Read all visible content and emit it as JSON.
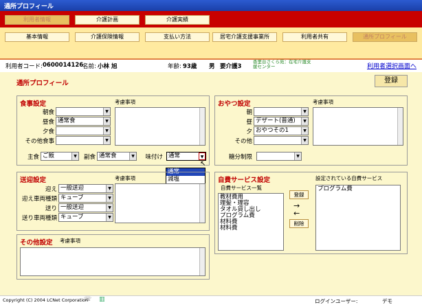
{
  "window": {
    "title": "通所プロフィール"
  },
  "nav_row1": [
    "利用者情報",
    "介護計画",
    "介護実績"
  ],
  "nav_row2": [
    "基本情報",
    "介護保険情報",
    "支払い方法",
    "居宅介護支援事業所",
    "利用者共有",
    "通所プロフィール"
  ],
  "userinfo": {
    "code_label": "利用者コード:",
    "code": "0600014126",
    "name_label": "名前:",
    "name": "小林  旭",
    "age_label": "年齢:",
    "age": "93歳",
    "sex": "男",
    "care_level": "要介護3",
    "facility_line1": "香里台さくら苑：在宅介護支",
    "facility_line2": "援センター",
    "back_link": "利用者選択画面へ"
  },
  "page_title": "通所プロフィール",
  "register_label": "登録",
  "meal": {
    "title": "食事設定",
    "note_label": "考慮事項",
    "rows": [
      {
        "label": "朝食",
        "value": ""
      },
      {
        "label": "昼食",
        "value": "通常食"
      },
      {
        "label": "夕食",
        "value": ""
      },
      {
        "label": "その他食事",
        "value": ""
      }
    ],
    "staple_label": "主食",
    "staple_value": "ご飯",
    "side_label": "副食",
    "side_value": "通常食",
    "seasoning_label": "味付け",
    "seasoning_value": "通常",
    "seasoning_options": [
      "通常",
      "減塩"
    ]
  },
  "snack": {
    "title": "おやつ設定",
    "note_label": "考慮事項",
    "rows": [
      {
        "label": "朝",
        "value": ""
      },
      {
        "label": "昼",
        "value": "デザート(普通)"
      },
      {
        "label": "夕",
        "value": "おやつその1"
      },
      {
        "label": "その他",
        "value": ""
      }
    ],
    "sugar_label": "糖分制限",
    "sugar_value": ""
  },
  "transport": {
    "title": "送迎設定",
    "note_label": "考慮事項",
    "rows": [
      {
        "label": "迎え",
        "value": "一般送迎"
      },
      {
        "label": "迎え車両種類",
        "value": "キューブ"
      },
      {
        "label": "送り",
        "value": "一般送迎"
      },
      {
        "label": "送り車両種類",
        "value": "キューブ"
      }
    ]
  },
  "other": {
    "title": "その他設定",
    "note_label": "考慮事項"
  },
  "selfpay": {
    "title": "自費サービス設定",
    "list_label": "自費サービス一覧",
    "set_label": "設定されている自費サービス",
    "available": [
      "教材費用",
      "理髪・理容",
      "タオル貸し出し",
      "プログラム費",
      "材料費",
      "材料費"
    ],
    "selected": [
      "プログラム費"
    ],
    "register_label": "登録",
    "delete_label": "削除",
    "arrow_right": "→",
    "arrow_left": "←"
  },
  "statusbar": {
    "copyright": "Copyright (C) 2004 LCNet Corporation",
    "login_label": "ログインユーザー:",
    "login_user": "デモ"
  },
  "colors": {
    "accent_red": "#c80000",
    "title_blue": "#1a3fa8",
    "panel_bg": "#fcf7cc",
    "link_blue": "#0000cc"
  }
}
